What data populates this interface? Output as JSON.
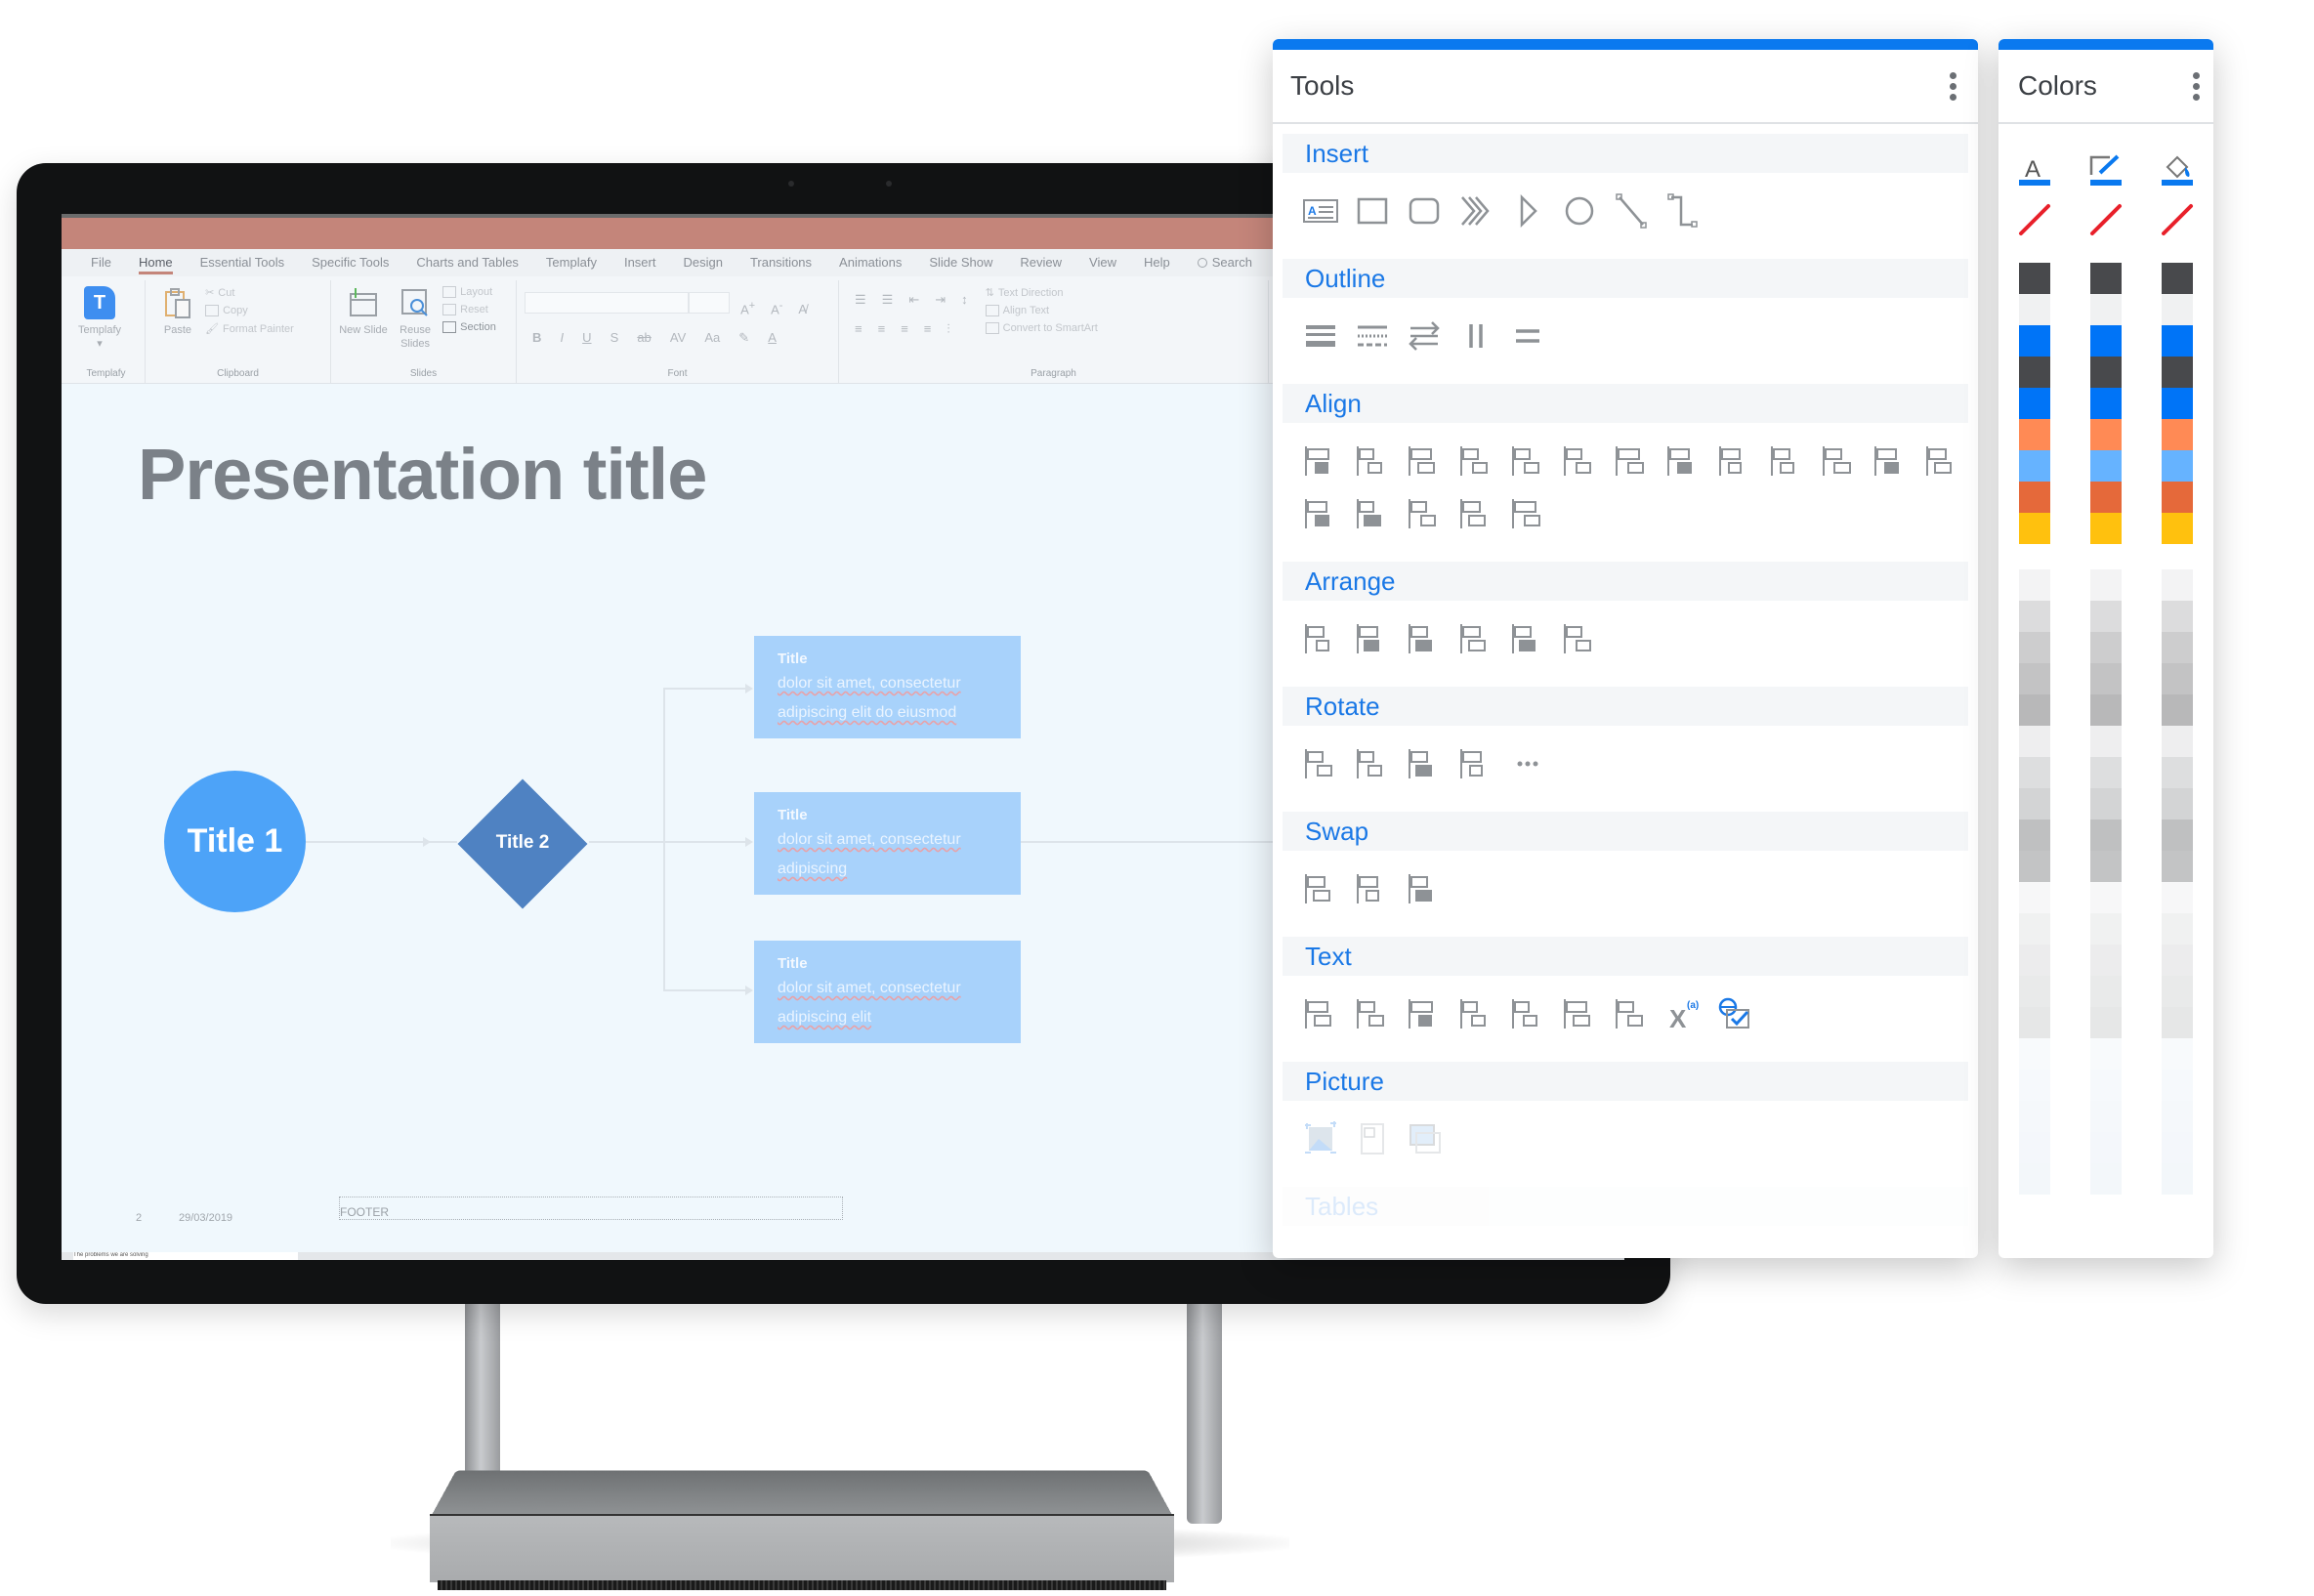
{
  "powerpoint": {
    "tabs": [
      "File",
      "Home",
      "Essential Tools",
      "Specific Tools",
      "Charts and Tables",
      "Templafy",
      "Insert",
      "Design",
      "Transitions",
      "Animations",
      "Slide Show",
      "Review",
      "View",
      "Help",
      "Search"
    ],
    "active_tab": "Home",
    "ribbon": {
      "templafy": {
        "button": "Templafy",
        "logo_letter": "T",
        "group": "Templafy"
      },
      "clipboard": {
        "paste": "Paste",
        "cut": "Cut",
        "copy": "Copy",
        "format_painter": "Format Painter",
        "group": "Clipboard"
      },
      "slides": {
        "new_slide": "New Slide",
        "reuse_slides": "Reuse Slides",
        "layout": "Layout",
        "reset": "Reset",
        "section": "Section",
        "group": "Slides"
      },
      "font": {
        "font_name": "",
        "font_size": "",
        "group": "Font"
      },
      "paragraph": {
        "text_direction": "Text Direction",
        "align_text": "Align Text",
        "convert_smartart": "Convert to SmartArt",
        "group": "Paragraph"
      }
    },
    "slide": {
      "title": "Presentation title",
      "circle_label": "Title 1",
      "diamond_label": "Title 2",
      "cards": [
        {
          "title": "Title",
          "line1": "dolor sit amet, consectetur",
          "line2": "adipiscing elit do eiusmod"
        },
        {
          "title": "Title",
          "line1": "dolor sit amet, consectetur",
          "line2": "adipiscing"
        },
        {
          "title": "Title",
          "line1": "dolor sit amet, consectetur",
          "line2": "adipiscing elit"
        }
      ],
      "footer_page": "2",
      "footer_date": "29/03/2019",
      "footer_text": "FOOTER",
      "notes_text": "The problems we are solving"
    },
    "colors": {
      "titlebar": "#c4857a",
      "circle": "#4da3f8",
      "diamond": "#4f82c2",
      "card": "#a8d2fb"
    }
  },
  "tools_panel": {
    "title": "Tools",
    "accent": "#0a79ef",
    "sections": [
      {
        "label": "Insert",
        "icons": [
          "text-box-icon",
          "rectangle-icon",
          "rounded-rectangle-icon",
          "chevron-icon",
          "triangle-icon",
          "oval-icon",
          "line-icon",
          "elbow-connector-icon"
        ]
      },
      {
        "label": "Outline",
        "icons": [
          "line-weight-icon",
          "dash-type-icon",
          "arrows-icon",
          "vertical-lines-icon",
          "horizontal-lines-icon"
        ]
      },
      {
        "label": "Align",
        "icons": [
          "align-left-icon",
          "align-right-icon",
          "align-top-icon",
          "align-center-icon",
          "align-middle-icon",
          "align-bottom-icon",
          "stretch-horizontal-icon",
          "stretch-vertical-icon",
          "align-to-center-icon",
          "distribute-horizontal-icon",
          "distribute-horizontal-spacing-icon",
          "distribute-equal-icon",
          "stack-vertical-icon",
          "stack-vertical-2-icon",
          "distribute-vertical-icon",
          "arrange-down-icon",
          "text-box-align-icon",
          "align-to-selection-icon"
        ]
      },
      {
        "label": "Arrange",
        "icons": [
          "group-icon",
          "ungroup-icon",
          "bring-forward-icon",
          "bring-to-front-icon",
          "send-backward-icon",
          "send-to-back-icon"
        ]
      },
      {
        "label": "Rotate",
        "icons": [
          "rotate-right-icon",
          "rotate-left-icon",
          "flip-vertical-icon",
          "flip-horizontal-icon",
          "more-icon"
        ]
      },
      {
        "label": "Swap",
        "icons": [
          "swap-positions-icon",
          "swap-horizontal-icon",
          "swap-vertical-icon"
        ]
      },
      {
        "label": "Text",
        "icons": [
          "text-fill-icon",
          "text-autofit-icon",
          "text-split-icon",
          "text-remove-icon",
          "text-strike-icon",
          "text-grid-icon",
          "text-replace-icon",
          "footnote-icon",
          "language-check-icon"
        ]
      },
      {
        "label": "Picture",
        "icons": [
          "crop-picture-icon",
          "picture-page-icon",
          "replace-picture-icon"
        ]
      },
      {
        "label": "Tables",
        "icons": []
      }
    ]
  },
  "colors_panel": {
    "title": "Colors",
    "columns": [
      {
        "tool": "font-color-icon"
      },
      {
        "tool": "line-color-icon"
      },
      {
        "tool": "fill-color-icon"
      }
    ],
    "no_color": "#e8202a",
    "theme_swatches": [
      "#48494c",
      "#f0f1f2",
      "#0074f7",
      "#48494c",
      "#0074f7",
      "#ff8a55",
      "#66b3ff",
      "#e5693a",
      "#ffc10e"
    ],
    "tint_swatches": [
      "#f3f3f4",
      "#dcdcdd",
      "#cdcdce",
      "#c3c3c4",
      "#b8b8b9",
      "#eeeeef",
      "#dddedf",
      "#d3d4d5",
      "#bfc0c1",
      "#c3c4c5",
      "#f7f7f8",
      "#f0f1f1",
      "#ececed",
      "#e9eaea",
      "#e6e7e7",
      "#f8fafc",
      "#f6f9fc",
      "#f5f8fb",
      "#f4f7fb",
      "#f3f7fa"
    ]
  }
}
